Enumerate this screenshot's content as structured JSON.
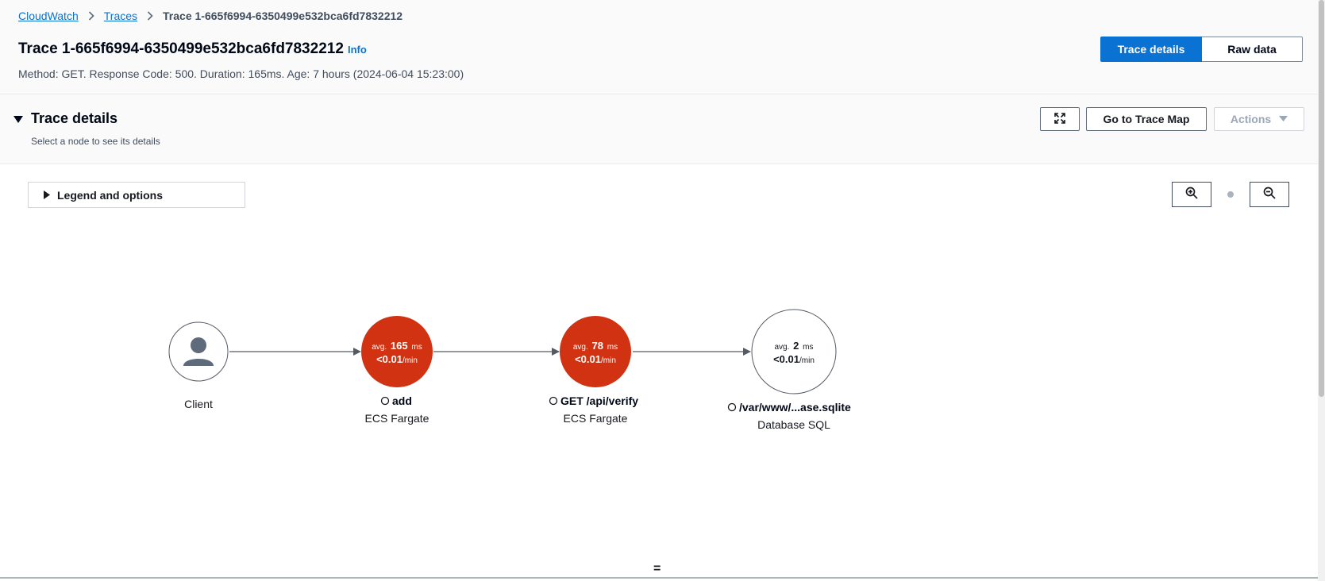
{
  "breadcrumb": {
    "items": [
      "CloudWatch",
      "Traces"
    ],
    "current": "Trace 1-665f6994-6350499e532bca6fd7832212"
  },
  "page": {
    "title": "Trace 1-665f6994-6350499e532bca6fd7832212",
    "info_label": "Info",
    "subtitle": "Method: GET. Response Code: 500. Duration: 165ms. Age: 7 hours (2024-06-04 15:23:00)"
  },
  "view_toggle": {
    "options": [
      "Trace details",
      "Raw data"
    ],
    "selected": "Trace details"
  },
  "section": {
    "title": "Trace details",
    "description": "Select a node to see its details",
    "go_to_trace_map": "Go to Trace Map",
    "actions": "Actions"
  },
  "legend": {
    "label": "Legend and options"
  },
  "resize_handle": "=",
  "graph": {
    "colors": {
      "error": "#d13212",
      "edge": "#545b64",
      "node_border": "#545b64"
    },
    "nodes": [
      {
        "id": "client",
        "icon": "user-icon",
        "name": "Client",
        "type": ""
      },
      {
        "id": "add",
        "avg_prefix": "avg.",
        "avg_value": "165",
        "avg_unit": "ms",
        "rate_value": "<0.01",
        "rate_unit": "/min",
        "name": "add",
        "type": "ECS Fargate",
        "status": "error"
      },
      {
        "id": "verify",
        "avg_prefix": "avg.",
        "avg_value": "78",
        "avg_unit": "ms",
        "rate_value": "<0.01",
        "rate_unit": "/min",
        "name": "GET /api/verify",
        "type": "ECS Fargate",
        "status": "error"
      },
      {
        "id": "db",
        "avg_prefix": "avg.",
        "avg_value": "2",
        "avg_unit": "ms",
        "rate_value": "<0.01",
        "rate_unit": "/min",
        "name": "/var/www/...ase.sqlite",
        "type": "Database SQL",
        "status": "ok"
      }
    ]
  }
}
